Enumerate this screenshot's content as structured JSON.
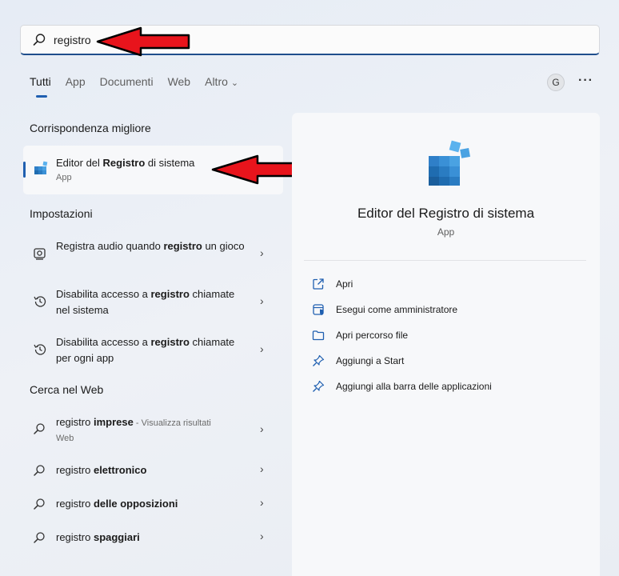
{
  "search": {
    "value": "registro"
  },
  "tabs": [
    {
      "label": "Tutti",
      "active": true
    },
    {
      "label": "App"
    },
    {
      "label": "Documenti"
    },
    {
      "label": "Web"
    },
    {
      "label": "Altro"
    }
  ],
  "avatar": {
    "initial": "G"
  },
  "more": {
    "label": "···"
  },
  "best_match": {
    "section_title": "Corrispondenza migliore",
    "title_pre": "Editor del ",
    "title_bold": "Registro",
    "title_post": " di sistema",
    "subtitle": "App",
    "icon": "registry-editor-icon"
  },
  "settings": {
    "section_title": "Impostazioni",
    "items": [
      {
        "pre": "Registra audio quando ",
        "bold": "registro",
        "post": " un gioco",
        "icon": "record-icon"
      },
      {
        "pre": "Disabilita accesso a ",
        "bold": "registro",
        "post": " chiamate nel sistema",
        "icon": "history-icon"
      },
      {
        "pre": "Disabilita accesso a ",
        "bold": "registro",
        "post": " chiamate per ogni app",
        "icon": "history-icon"
      }
    ]
  },
  "web": {
    "section_title": "Cerca nel Web",
    "items": [
      {
        "pre": "registro ",
        "bold": "imprese",
        "hint": " - Visualizza risultati",
        "web": "Web"
      },
      {
        "pre": "registro ",
        "bold": "elettronico"
      },
      {
        "pre": "registro ",
        "bold": "delle opposizioni"
      },
      {
        "pre": "registro ",
        "bold": "spaggiari"
      }
    ]
  },
  "detail": {
    "title": "Editor del Registro di sistema",
    "subtitle": "App",
    "actions": [
      {
        "label": "Apri",
        "icon": "open-icon"
      },
      {
        "label": "Esegui come amministratore",
        "icon": "shield-admin-icon"
      },
      {
        "label": "Apri percorso file",
        "icon": "folder-icon"
      },
      {
        "label": "Aggiungi a Start",
        "icon": "pin-icon"
      },
      {
        "label": "Aggiungi alla barra delle applicazioni",
        "icon": "pin-icon"
      }
    ]
  },
  "colors": {
    "accent": "#1f5fb0",
    "arrow": "#e8141c"
  }
}
